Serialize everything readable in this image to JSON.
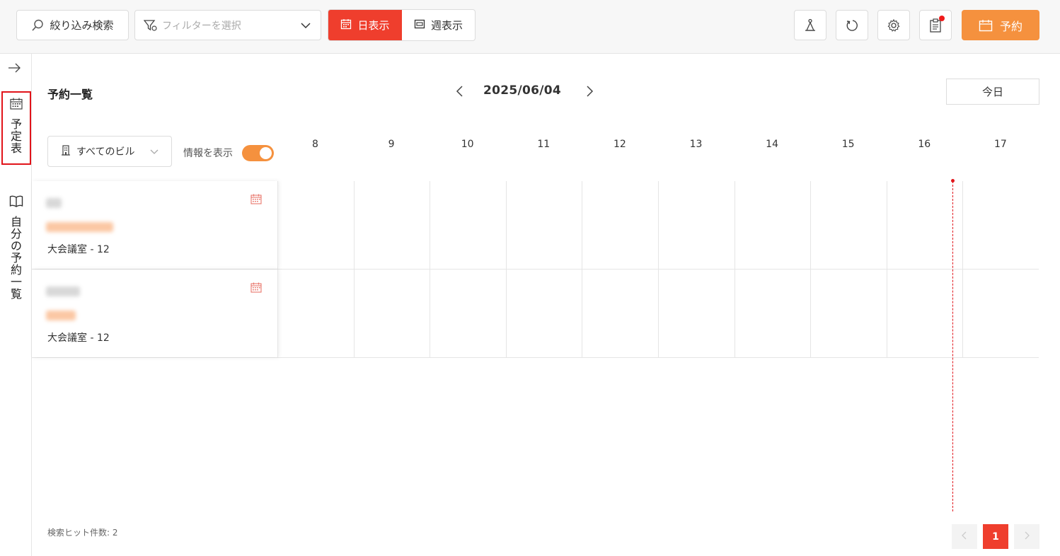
{
  "toolbar": {
    "search_label": "絞り込み検索",
    "filter_placeholder": "フィルターを選択",
    "day_view_label": "日表示",
    "week_view_label": "週表示",
    "reserve_label": "予約",
    "active_view": "day",
    "notification_dot": true
  },
  "sidebar": {
    "schedule_label": "予定表",
    "my_reservations_label": "自分の予約一覧"
  },
  "header": {
    "title": "予約一覧",
    "date": "2025/06/04",
    "today_label": "今日"
  },
  "controls": {
    "building_label": "すべてのビル",
    "info_label": "情報を表示",
    "info_enabled": true
  },
  "hours": [
    "8",
    "9",
    "10",
    "11",
    "12",
    "13",
    "14",
    "15",
    "16",
    "17"
  ],
  "rooms": [
    {
      "name": "大会議室 - 12"
    },
    {
      "name": "大会議室 - 12"
    }
  ],
  "footer": {
    "hit_count": "検索ヒット件数: 2",
    "current_page": "1"
  },
  "colors": {
    "accent_red": "#ef3e2d",
    "accent_orange": "#f5913e",
    "now_line": "#e1141a"
  }
}
